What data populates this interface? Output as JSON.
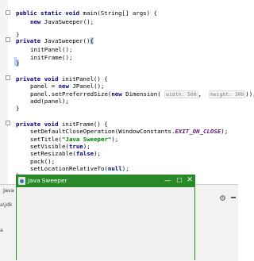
{
  "code": {
    "l1": {
      "kw": "public static void",
      "rest": " main(String[] args) {"
    },
    "l2": {
      "kw": "new",
      "rest": " JavaSweeper();"
    },
    "l3": "}",
    "l4": {
      "kw": "private",
      "rest": " JavaSweeper()",
      "brace": "{"
    },
    "l5": "initPanel();",
    "l6": "initFrame();",
    "l7": "}",
    "l8": {
      "kw": "private void",
      "rest": " initPanel() {"
    },
    "l9": {
      "pre": "panel = ",
      "kw": "new",
      "rest": " JPanel();"
    },
    "l10": {
      "pre": "panel.setPreferredSize(",
      "kw": "new",
      "mid": " Dimension( ",
      "hint1": "width: 500",
      "sep": ",  ",
      "hint2": "height: 300",
      "end": "));"
    },
    "l11": "add(panel);",
    "l12": "}",
    "l13": {
      "kw": "private void",
      "rest": " initFrame() {"
    },
    "l14": {
      "pre": "setDefaultCloseOperation(WindowConstants.",
      "it": "EXIT_ON_CLOSE",
      "end": ");"
    },
    "l15": {
      "pre": "setTitle(",
      "str": "\"Java Sweeper\"",
      "end": ");"
    },
    "l16": {
      "pre": "setVisible(",
      "kw": "true",
      "end": ");"
    },
    "l17": {
      "pre": "setResizable(",
      "kw": "false",
      "end": ");"
    },
    "l18": "pack();",
    "l19": {
      "pre": "setLocationRelativeTo(",
      "kw": "null",
      "end": ");"
    },
    "l20": "}"
  },
  "bottom": {
    "tab_label": "Java",
    "console_line1": "a\\jdk",
    "console_line2": "a"
  },
  "java_window": {
    "title": "Java Sweeper",
    "min": "—",
    "max": "☐",
    "close": "✕"
  },
  "colors": {
    "keyword": "#000080",
    "string": "#008000",
    "window_accent": "#2a8a2a"
  }
}
